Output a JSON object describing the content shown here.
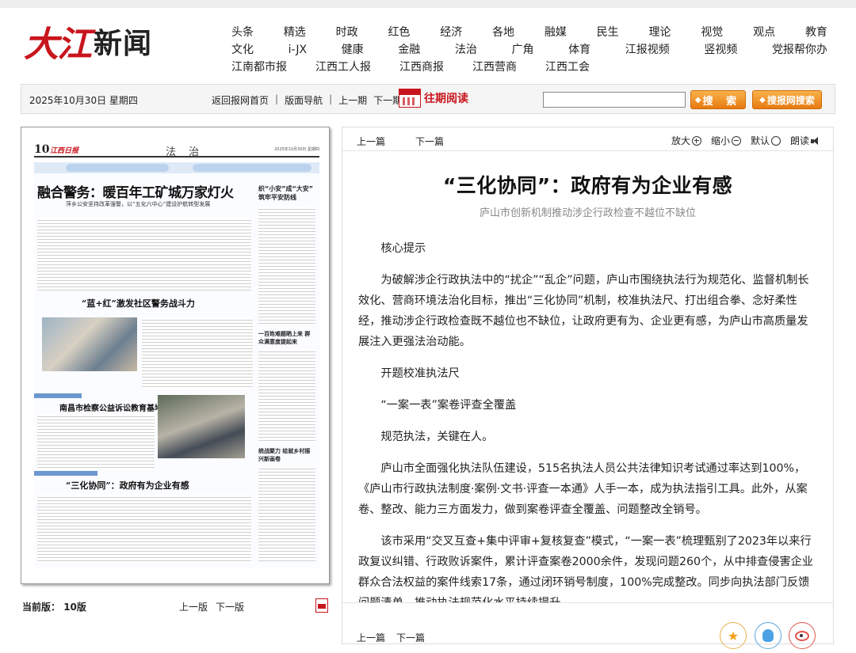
{
  "logo": {
    "red": "大江",
    "black": "新闻"
  },
  "nav": {
    "row1": [
      "头条",
      "精选",
      "时政",
      "红色",
      "经济",
      "各地",
      "融媒",
      "民生",
      "理论",
      "视觉",
      "观点",
      "教育"
    ],
    "row2": [
      "文化",
      "i-JX",
      "健康",
      "金融",
      "法治",
      "广角",
      "体育",
      "江报视频",
      "竖视频",
      "党报帮你办"
    ],
    "row3": [
      "江南都市报",
      "江西工人报",
      "江西商报",
      "江西营商",
      "江西工会"
    ]
  },
  "toolbar": {
    "date": "2025年10月30日 星期四",
    "home": "返回报网首页",
    "sep": "|",
    "layout_nav": "版面导航",
    "prev_issue": "上一期",
    "next_issue": "下一期",
    "past": "往期阅读",
    "search_value": "",
    "search_btn": "搜 索",
    "site_search_btn": "搜报网搜索"
  },
  "paper": {
    "page_num": "10",
    "brand": "江西日报",
    "section": "法 治",
    "date_line": "2025年10月30日 星期四",
    "headline_main": "融合警务：暖百年工矿城万家灯火",
    "headline_main_sub": "萍乡公安坚持改革强警，以“五化六中心”建设护航转型发展",
    "headline_side": "织“小安”成“大安” 筑牢平安防线",
    "headline_2": "“蓝+红”激发社区警务战斗力",
    "headline_side2": "一百姓难题晒上来 群众满意度提起来",
    "headline_3": "南昌市检察公益诉讼教育基地揭牌",
    "headline_side3": "统战聚力 绘就乡村振兴新画卷",
    "headline_4": "“三化协同”：政府有为企业有感"
  },
  "below_paper": {
    "current_label": "当前版：",
    "current_value": "10版",
    "prev": "上一版",
    "next": "下一版"
  },
  "article": {
    "prev": "上一篇",
    "next": "下一篇",
    "zoom_in": "放大",
    "zoom_out": "缩小",
    "default": "默认",
    "read": "朗读",
    "title": "“三化协同”：政府有为企业有感",
    "subtitle": "庐山市创新机制推动涉企行政检查不越位不缺位",
    "paragraphs": [
      "核心提示",
      "为破解涉企行政执法中的“扰企”“乱企”问题，庐山市围绕执法行为规范化、监督机制长效化、营商环境法治化目标，推出“三化协同”机制，校准执法尺、打出组合拳、念好柔性经，推动涉企行政检查既不越位也不缺位，让政府更有为、企业更有感，为庐山市高质量发展注入更强法治动能。",
      "开题校准执法尺",
      "“一案一表”案卷评查全覆盖",
      "规范执法，关键在人。",
      "庐山市全面强化执法队伍建设，515名执法人员公共法律知识考试通过率达到100%，《庐山市行政执法制度·案例·文书·评查一本通》人手一本，成为执法指引工具。此外，从案卷、整改、能力三方面发力，做到案卷评查全覆盖、问题整改全销号。",
      "该市采用“交叉互查+集中评审+复核复查”模式，“一案一表”梳理甄别了2023年以来行政复议纠错、行政败诉案件，累计评查案卷2000余件，发现问题260个，从中排查侵害企业群众合法权益的案件线索17条，通过闭环销号制度，100%完成整改。同步向执法部门反馈问题清单，推动执法规范化水平持续提升。"
    ],
    "bottom_prev": "上一篇",
    "bottom_next": "下一篇"
  },
  "colors": {
    "brand_red": "#c8161d",
    "search_orange": "#f08c1e",
    "paper_blue": "#6c97cf"
  },
  "icons": [
    "calendar-icon",
    "zoom-in-icon",
    "zoom-out-icon",
    "default-size-icon",
    "speaker-icon",
    "pdf-icon",
    "favorite-star-icon",
    "qq-icon",
    "weibo-icon"
  ]
}
